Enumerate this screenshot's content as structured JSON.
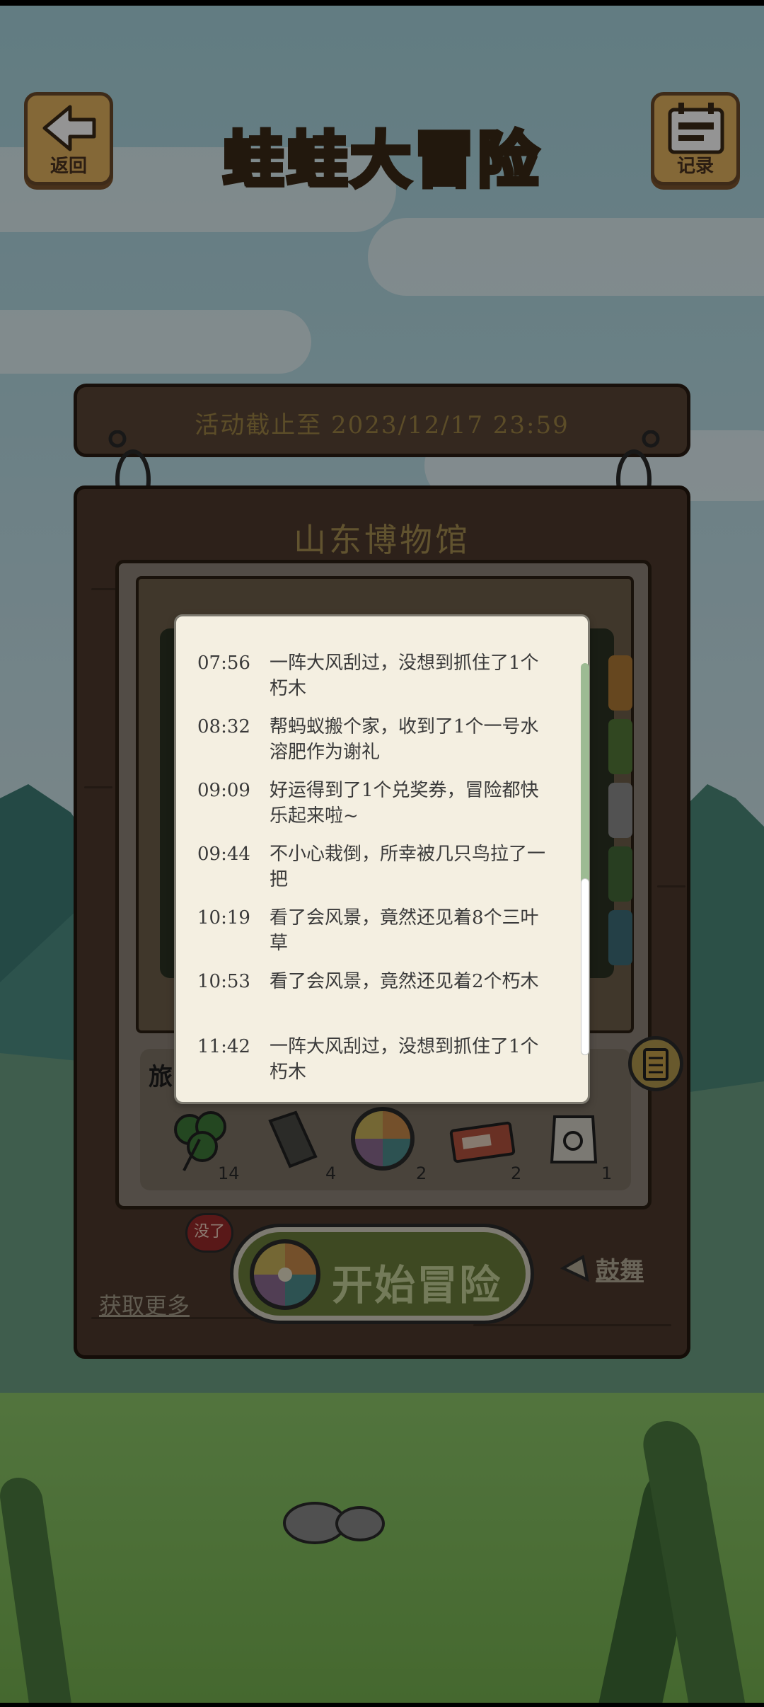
{
  "header": {
    "back_label": "返回",
    "record_label": "记录",
    "title": "蛙蛙大冒险"
  },
  "event": {
    "deadline": "活动截止至 2023/12/17 23:59",
    "location": "山东博物馆"
  },
  "log": [
    {
      "time": "07:56",
      "text": "一阵大风刮过，没想到抓住了1个朽木"
    },
    {
      "time": "08:32",
      "text": "帮蚂蚁搬个家，收到了1个一号水溶肥作为谢礼"
    },
    {
      "time": "09:09",
      "text": "好运得到了1个兑奖券，冒险都快乐起来啦~"
    },
    {
      "time": "09:44",
      "text": "不小心栽倒，所幸被几只鸟拉了一把"
    },
    {
      "time": "10:19",
      "text": "看了会风景，竟然还见着8个三叶草"
    },
    {
      "time": "10:53",
      "text": "看了会风景，竟然还见着2个朽木"
    },
    {
      "time": "11:42",
      "text": "一阵大风刮过，没想到抓住了1个朽木"
    }
  ],
  "items": {
    "partial_label": "旅",
    "counts": [
      "14",
      "4",
      "2",
      "2",
      "1"
    ],
    "icons": [
      "clover-icon",
      "rotten-wood-icon",
      "adventure-wheel-icon",
      "ticket-icon",
      "fertilizer-bag-icon"
    ]
  },
  "actions": {
    "start_label": "开始冒险",
    "badge_label": "没了",
    "get_more_label": "获取更多",
    "cheer_label": "鼓舞"
  },
  "colors": {
    "wood_dark": "#4f3a2d",
    "panel_beige": "#f4efe1",
    "start_green": "#6c7f3c",
    "badge_red": "#9a2a2a"
  }
}
